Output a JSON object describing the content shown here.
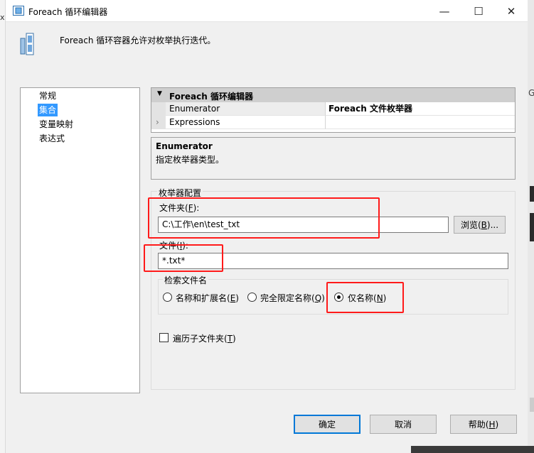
{
  "window": {
    "title": "Foreach 循环编辑器",
    "controls": {
      "minimize": "—",
      "maximize": "☐",
      "close": "✕"
    }
  },
  "description": "Foreach 循环容器允许对枚举执行迭代。",
  "nav": {
    "items": [
      {
        "label": "常规",
        "selected": false
      },
      {
        "label": "集合",
        "selected": true
      },
      {
        "label": "变量映射",
        "selected": false
      },
      {
        "label": "表达式",
        "selected": false
      }
    ]
  },
  "property_grid": {
    "category": "Foreach 循环编辑器",
    "rows": [
      {
        "name": "Enumerator",
        "value": "Foreach 文件枚举器"
      },
      {
        "name": "Expressions",
        "value": ""
      }
    ]
  },
  "help": {
    "title": "Enumerator",
    "text": "指定枚举器类型。"
  },
  "config": {
    "legend": "枚举器配置",
    "folder_label": {
      "text": "文件夹(",
      "key": "F",
      "suffix": "):"
    },
    "folder_value": "C:\\工作\\en\\test_txt",
    "browse_button": {
      "text": "浏览(",
      "key": "B",
      "suffix": ")..."
    },
    "files_label": {
      "text": "文件(",
      "key": "I",
      "suffix": "):"
    },
    "files_value": "*.txt*",
    "retrieve_group": "检索文件名",
    "radios": [
      {
        "text": "名称和扩展名(",
        "key": "E",
        "suffix": ")",
        "checked": false
      },
      {
        "text": "完全限定名称(",
        "key": "Q",
        "suffix": ")",
        "checked": false
      },
      {
        "text": "仅名称(",
        "key": "N",
        "suffix": ")",
        "checked": true
      }
    ],
    "traverse": {
      "text": "遍历子文件夹(",
      "key": "T",
      "suffix": ")",
      "checked": false
    }
  },
  "buttons": {
    "ok": "确定",
    "cancel": "取消",
    "help": {
      "text": "帮助(",
      "key": "H",
      "suffix": ")"
    }
  },
  "background": {
    "right_letter": "G",
    "left_letter": "x"
  },
  "colors": {
    "selection": "#3399ff",
    "highlight_box": "#ff1a1a",
    "default_button_border": "#0078d7"
  }
}
